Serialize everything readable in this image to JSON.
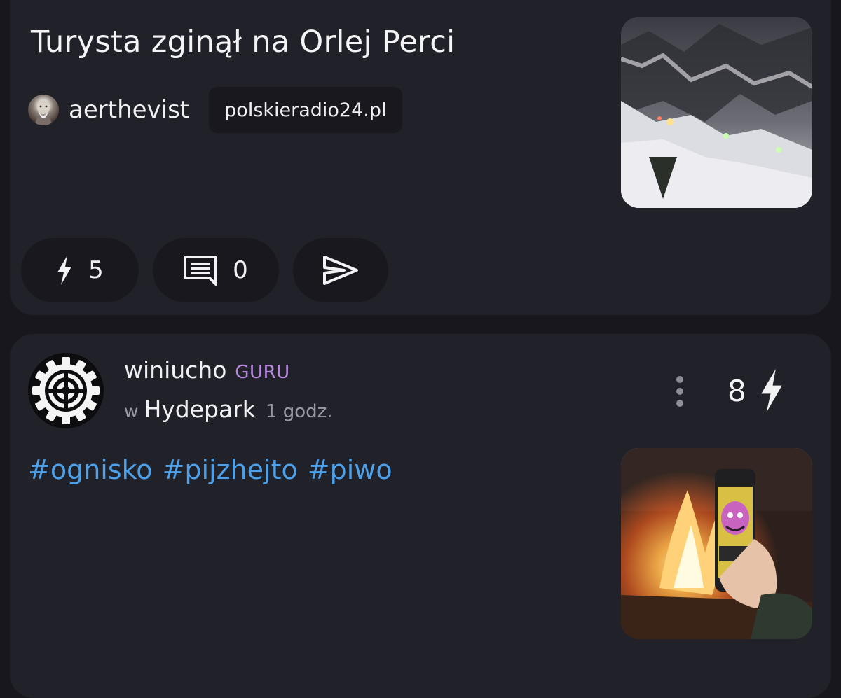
{
  "post1": {
    "title": "Turysta zginął na Orlej Perci",
    "author": "aerthevist",
    "domain": "polskieradio24.pl",
    "votes": "5",
    "comments": "0"
  },
  "post2": {
    "author": "winiucho",
    "rank": "GURU",
    "in_prefix": "w",
    "community": "Hydepark",
    "time": "1 godz.",
    "votes": "8",
    "tags": [
      "#ognisko",
      "#pijzhejto",
      "#piwo"
    ]
  },
  "icons": {
    "vote": "lightning-icon",
    "comments": "comment-icon",
    "share": "send-icon",
    "more": "more-vertical-icon"
  },
  "colors": {
    "background": "#17171d",
    "card": "#212129",
    "pill": "#18181e",
    "rank": "#b78adf",
    "tag": "#4ea0e8"
  }
}
